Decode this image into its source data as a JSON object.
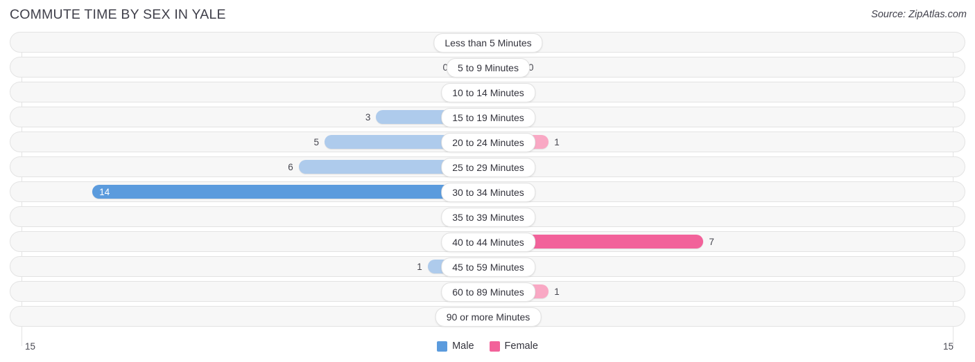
{
  "header": {
    "title": "COMMUTE TIME BY SEX IN YALE",
    "source": "Source: ZipAtlas.com"
  },
  "legend": {
    "male_label": "Male",
    "female_label": "Female",
    "male_color": "#5b9bdd",
    "female_color": "#f2629a"
  },
  "axis": {
    "left_max_label": "15",
    "right_max_label": "15"
  },
  "colors": {
    "male_strong": "#5b9bdd",
    "male_light": "#aecbec",
    "female_strong": "#f2629a",
    "female_light": "#f9a8c4",
    "track": "#f7f7f7",
    "track_border": "#e3e3e3",
    "gridline": "#e2e2e2"
  },
  "chart_data": {
    "type": "bar",
    "title": "COMMUTE TIME BY SEX IN YALE",
    "subtype": "diverging-horizontal-bar",
    "xlabel": "",
    "ylabel": "",
    "xlim": [
      15,
      15
    ],
    "grid": true,
    "legend_position": "bottom-center",
    "categories": [
      "Less than 5 Minutes",
      "5 to 9 Minutes",
      "10 to 14 Minutes",
      "15 to 19 Minutes",
      "20 to 24 Minutes",
      "25 to 29 Minutes",
      "30 to 34 Minutes",
      "35 to 39 Minutes",
      "40 to 44 Minutes",
      "45 to 59 Minutes",
      "60 to 89 Minutes",
      "90 or more Minutes"
    ],
    "series": [
      {
        "name": "Male",
        "side": "left",
        "color": "#5b9bdd",
        "values": [
          0,
          0,
          0,
          3,
          5,
          6,
          14,
          0,
          0,
          1,
          0,
          0
        ]
      },
      {
        "name": "Female",
        "side": "right",
        "color": "#f2629a",
        "values": [
          0,
          0,
          0,
          0,
          1,
          0,
          0,
          0,
          7,
          0,
          1,
          0
        ]
      }
    ]
  },
  "rows": [
    {
      "label": "Less than 5 Minutes",
      "male": "0",
      "female": "0"
    },
    {
      "label": "5 to 9 Minutes",
      "male": "0",
      "female": "0"
    },
    {
      "label": "10 to 14 Minutes",
      "male": "0",
      "female": "0"
    },
    {
      "label": "15 to 19 Minutes",
      "male": "3",
      "female": "0"
    },
    {
      "label": "20 to 24 Minutes",
      "male": "5",
      "female": "1"
    },
    {
      "label": "25 to 29 Minutes",
      "male": "6",
      "female": "0"
    },
    {
      "label": "30 to 34 Minutes",
      "male": "14",
      "female": "0"
    },
    {
      "label": "35 to 39 Minutes",
      "male": "0",
      "female": "0"
    },
    {
      "label": "40 to 44 Minutes",
      "male": "0",
      "female": "7"
    },
    {
      "label": "45 to 59 Minutes",
      "male": "1",
      "female": "0"
    },
    {
      "label": "60 to 89 Minutes",
      "male": "0",
      "female": "1"
    },
    {
      "label": "90 or more Minutes",
      "male": "0",
      "female": "0"
    }
  ]
}
